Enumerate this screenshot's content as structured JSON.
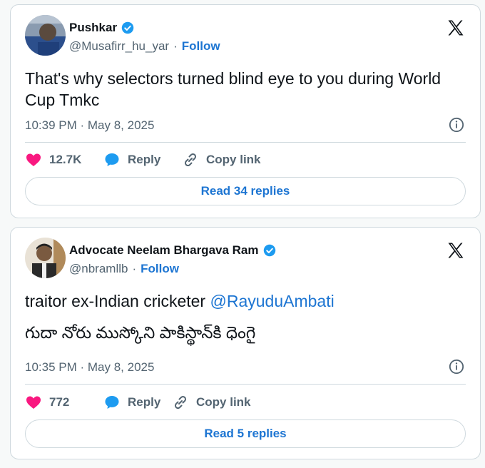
{
  "tweets": [
    {
      "name": "Pushkar",
      "handle": "@Musafirr_hu_yar",
      "separator": "·",
      "follow_label": "Follow",
      "text_lines": [
        "That's why selectors turned blind eye to you during World",
        "Cup Tmkc"
      ],
      "timestamp": "10:39 PM · May 8, 2025",
      "likes": "12.7K",
      "reply_label": "Reply",
      "copy_link_label": "Copy link",
      "read_replies_label": "Read 34 replies"
    },
    {
      "name": "Advocate Neelam Bhargava Ram",
      "handle": "@nbramllb",
      "separator": "·",
      "follow_label": "Follow",
      "text_prefix": "traitor ex-Indian cricketer ",
      "mention": "@RayuduAmbati",
      "text_line2": "గుదా నోరు ముస్కోని పాకిస్థాన్‌కి ధెంగై",
      "timestamp": "10:35 PM · May 8, 2025",
      "likes": "772",
      "reply_label": "Reply",
      "copy_link_label": "Copy link",
      "read_replies_label": "Read 5 replies"
    }
  ],
  "icons": {
    "verified": "verified-badge-icon",
    "x_logo": "x-logo-icon",
    "info": "info-icon",
    "heart": "heart-icon",
    "reply": "reply-bubble-icon",
    "link": "link-icon"
  },
  "colors": {
    "accent": "#1d75d2",
    "heart": "#f91880",
    "verified": "#1d9bf0",
    "muted": "#536471"
  }
}
